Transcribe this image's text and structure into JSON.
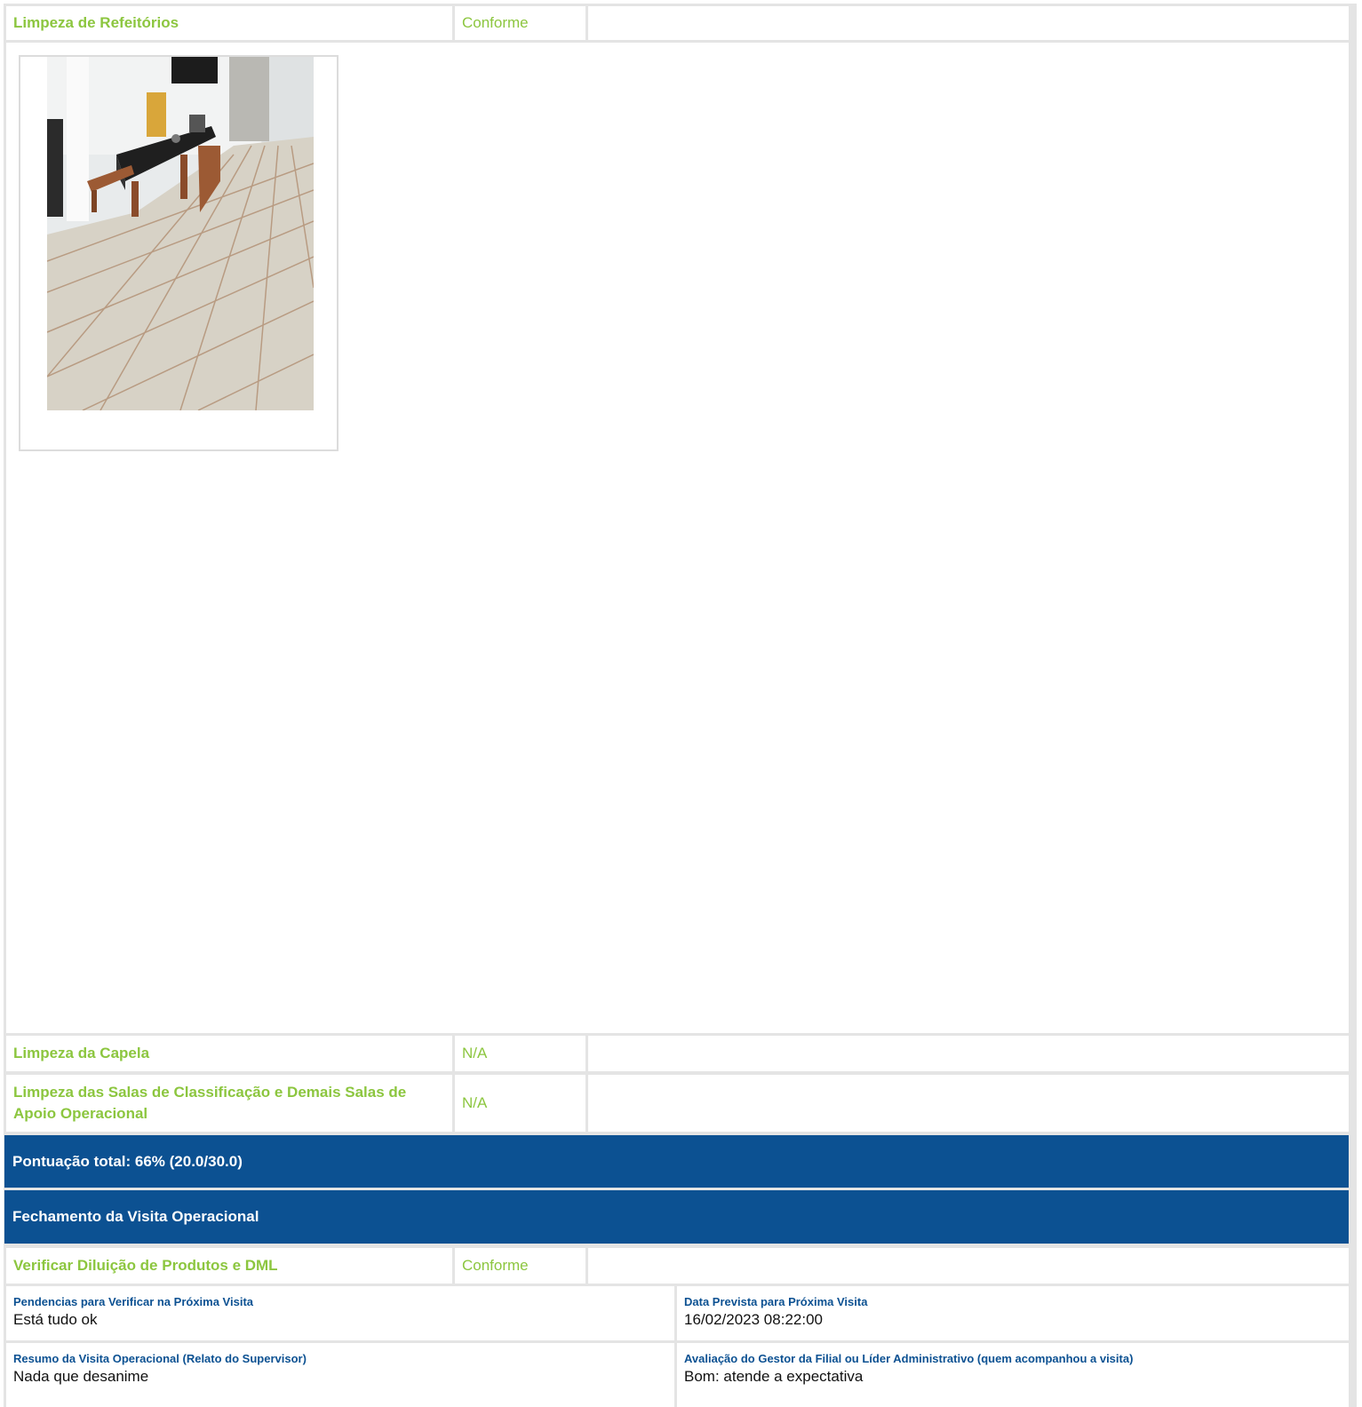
{
  "items_top": [
    {
      "title": "Limpeza de Refeitórios",
      "status": "Conforme",
      "photo_alt": "Foto do refeitório"
    }
  ],
  "items_mid": [
    {
      "title": "Limpeza da Capela",
      "status": "N/A"
    },
    {
      "title": "Limpeza das Salas de Classificação e Demais Salas de Apoio Operacional",
      "status": "N/A"
    }
  ],
  "score": {
    "label": "Pontuação total: 66% (20.0/30.0)",
    "percent": 66
  },
  "closing": {
    "title": "Fechamento da Visita Operacional",
    "item": {
      "title": "Verificar Diluição de Produtos e DML",
      "status": "Conforme"
    },
    "fields": [
      {
        "label": "Pendencias para Verificar na Próxima Visita",
        "value": "Está tudo ok"
      },
      {
        "label": "Data Prevista para Próxima Visita",
        "value": "16/02/2023 08:22:00"
      },
      {
        "label": "Resumo da Visita Operacional (Relato do Supervisor)",
        "value": "Nada que desanime"
      },
      {
        "label": "Avaliação do Gestor da Filial ou Líder Administrativo (quem acompanhou a visita)",
        "value": "Bom: atende a expectativa"
      }
    ]
  },
  "colors": {
    "status_green": "#8cc63f",
    "band_blue": "#0c5192",
    "border_gray": "#e4e4e4"
  }
}
